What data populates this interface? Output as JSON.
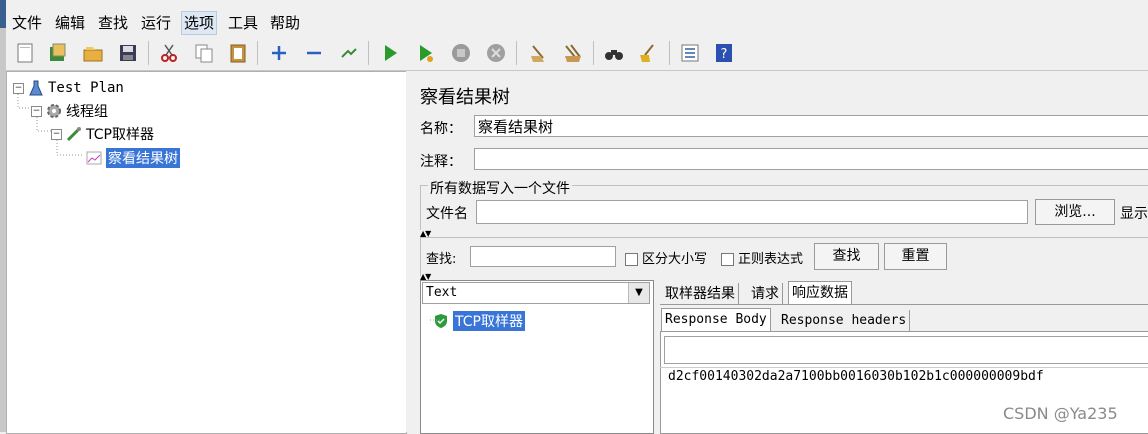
{
  "menu": [
    "文件",
    "编辑",
    "查找",
    "运行",
    "选项",
    "工具",
    "帮助"
  ],
  "toolbar_icons": [
    "new-icon",
    "templates-icon",
    "open-icon",
    "save-icon",
    "cut-icon",
    "copy-icon",
    "paste-icon",
    "expand-icon",
    "collapse-icon",
    "toggle-icon",
    "start-icon",
    "start-no-pause-icon",
    "stop-icon",
    "shutdown-icon",
    "clear-icon",
    "clear-all-icon",
    "search-icon",
    "reset-search-icon",
    "function-helper-icon",
    "help-icon"
  ],
  "tree": {
    "test_plan": "Test Plan",
    "thread_group": "线程组",
    "sampler": "TCP取样器",
    "listener": "察看结果树"
  },
  "panel": {
    "title": "察看结果树",
    "name_label": "名称：",
    "name_value": "察看结果树",
    "comment_label": "注释：",
    "comment_value": "",
    "file_group_title": "所有数据写入一个文件",
    "filename_label": "文件名",
    "filename_value": "",
    "browse_button": "浏览...",
    "display_label": "显示"
  },
  "search": {
    "label": "查找:",
    "value": "",
    "case_sensitive": "区分大小写",
    "regex": "正则表达式",
    "find_button": "查找",
    "reset_button": "重置"
  },
  "results": {
    "renderer": "Text",
    "sample": "TCP取样器",
    "tabs": [
      "取样器结果",
      "请求",
      "响应数据"
    ],
    "subtabs": [
      "Response Body",
      "Response headers"
    ],
    "response_search": "",
    "response_body": "d2cf00140302da2a7100bb0016030b102b1c000000009bdf"
  },
  "watermark": "CSDN @Ya235"
}
